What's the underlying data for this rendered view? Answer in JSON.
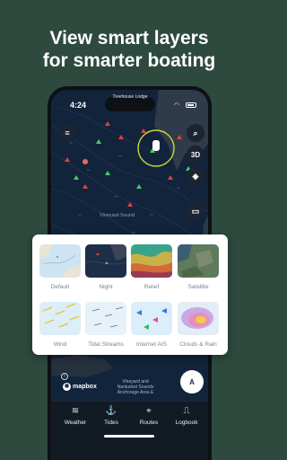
{
  "headline": {
    "line1": "View smart layers",
    "line2": "for smarter boating"
  },
  "status_bar": {
    "time": "4:24",
    "location": "Treehouse Lodge"
  },
  "map": {
    "label_sound": "Vineyard Sound",
    "anchorage_line1": "Vineyard and",
    "anchorage_line2": "Nantucket Sounds",
    "anchorage_line3": "Anchorage Area E",
    "attribution": "mapbox"
  },
  "controls": {
    "menu_icon": "menu-icon",
    "search_icon": "search-icon",
    "view_3d": "3D",
    "compass_label": "A"
  },
  "layers": [
    {
      "label": "Default"
    },
    {
      "label": "Night"
    },
    {
      "label": "Relief"
    },
    {
      "label": "Satellite"
    },
    {
      "label": "Wind"
    },
    {
      "label": "Tidal Streams"
    },
    {
      "label": "Internet AIS"
    },
    {
      "label": "Clouds & Rain"
    }
  ],
  "tabs": [
    {
      "label": "Weather",
      "icon": "wind-icon"
    },
    {
      "label": "Tides",
      "icon": "tide-icon"
    },
    {
      "label": "Routes",
      "icon": "routes-icon"
    },
    {
      "label": "Logbook",
      "icon": "bookmark-icon"
    }
  ],
  "colors": {
    "background": "#2e4a3e",
    "map": "#12243b",
    "card": "#ffffff"
  }
}
